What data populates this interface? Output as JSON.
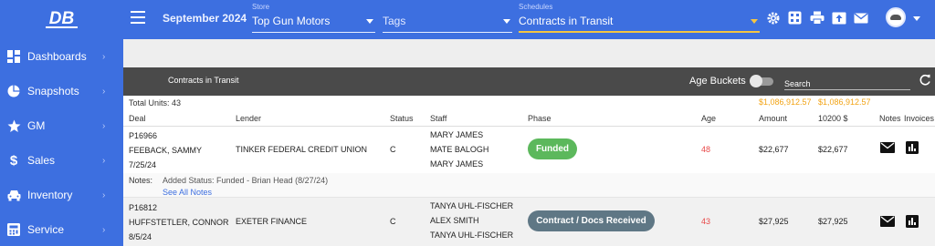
{
  "brand": {
    "logo_text": "DB"
  },
  "header": {
    "month": "September 2024",
    "store": {
      "label": "Store",
      "value": "Top Gun Motors"
    },
    "tags": {
      "placeholder": "Tags"
    },
    "schedule": {
      "label": "Schedules",
      "value": "Contracts in Transit"
    },
    "icons": [
      "gear-icon",
      "calculator-icon",
      "printer-icon",
      "upload-icon",
      "mail-icon"
    ],
    "accent_color": "#f5c542"
  },
  "sidebar": {
    "items": [
      {
        "label": "Dashboards",
        "icon": "dashboard-icon"
      },
      {
        "label": "Snapshots",
        "icon": "pie-chart-icon"
      },
      {
        "label": "GM",
        "icon": "star-icon"
      },
      {
        "label": "Sales",
        "icon": "dollar-icon"
      },
      {
        "label": "Inventory",
        "icon": "car-icon"
      },
      {
        "label": "Service",
        "icon": "calculator-icon"
      }
    ],
    "chevron": "›"
  },
  "report": {
    "title": "Contracts in Transit",
    "age_buckets_label": "Age Buckets",
    "search_placeholder": "Search",
    "total_units": "Total Units: 43",
    "total_amount": "$1,086,912.57",
    "total_10200": "$1,086,912.57"
  },
  "columns": [
    "Deal",
    "Lender",
    "Status",
    "Staff",
    "Phase",
    "Age",
    "Amount",
    "10200 $",
    "Notes",
    "Invoices"
  ],
  "rows": [
    {
      "deal_id": "P16966",
      "customer": "FEEBACK, SAMMY",
      "date": "7/25/24",
      "lender": "TINKER FEDERAL CREDIT UNION",
      "status": "C",
      "staff": [
        "MARY JAMES",
        "MATE BALOGH",
        "MARY JAMES"
      ],
      "phase": "Funded",
      "phase_color": "#5cb85c",
      "age": "48",
      "amount": "$22,677",
      "amount_10200": "$22,677",
      "notes_label": "Notes:",
      "note_text": "Added Status: Funded - Brian Head (8/27/24)",
      "see_all": "See All Notes"
    },
    {
      "deal_id": "P16812",
      "customer": "HUFFSTETLER, CONNOR",
      "date": "8/5/24",
      "lender": "EXETER FINANCE",
      "status": "C",
      "staff": [
        "TANYA UHL-FISCHER",
        "ALEX SMITH",
        "TANYA UHL-FISCHER"
      ],
      "phase": "Contract / Docs Received",
      "phase_color": "#5f7785",
      "age": "43",
      "amount": "$27,925",
      "amount_10200": "$27,925"
    }
  ]
}
